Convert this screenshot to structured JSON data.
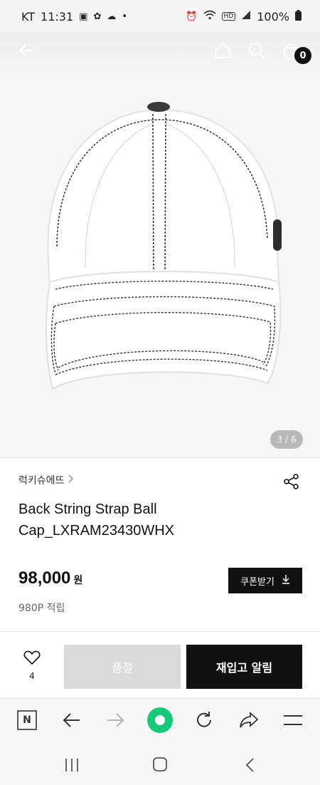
{
  "status_bar": {
    "carrier": "KT",
    "time": "11:31",
    "battery": "100%",
    "icons": [
      "gallery-icon",
      "app-icon",
      "cloud-icon",
      "dot-icon",
      "alarm-icon",
      "wifi-icon",
      "hd-icon",
      "signal-icon",
      "battery-icon"
    ]
  },
  "header": {
    "icons": [
      "back-arrow-icon",
      "home-icon",
      "search-icon",
      "shopping-bag-icon"
    ],
    "cart_count": "0"
  },
  "hero": {
    "image": "white-baseball-cap",
    "pager": "3 / 6"
  },
  "product": {
    "brand": "럭키슈에뜨",
    "title": "Back String Strap Ball Cap_LXRAM23430WHX",
    "price": "98,000",
    "currency": "원",
    "points": "980P 적립"
  },
  "coupon_button": {
    "label": "쿠폰받기"
  },
  "actions": {
    "wish_count": "4",
    "soldout_label": "품절",
    "restock_label": "재입고 알림"
  },
  "browser_toolbar": {
    "icons": [
      "naver-icon",
      "back-icon",
      "forward-icon",
      "green-dot-icon",
      "refresh-icon",
      "share-arrow-icon",
      "menu-icon"
    ],
    "naver_label": "N"
  },
  "system_nav": {
    "icons": [
      "recents-icon",
      "home-button-icon",
      "back-nav-icon"
    ]
  },
  "colors": {
    "primary": "#111111",
    "disabled": "#dadada",
    "accent_green": "#14c97a"
  }
}
